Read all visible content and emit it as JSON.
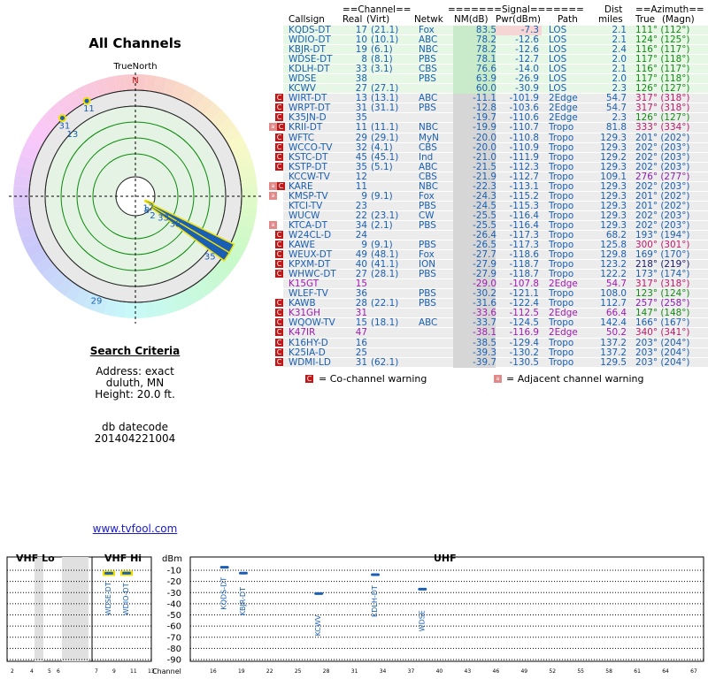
{
  "page": {
    "title": "All Channels",
    "north_label": "TrueNorth",
    "north_marker": "N",
    "search_criteria_heading": "Search Criteria",
    "address_line": "Address: exact",
    "city_line": "duluth, MN",
    "height_line": "Height: 20.0 ft.",
    "datecode_label": "db datecode",
    "datecode_value": "201404221004",
    "site_link": "www.tvfool.com"
  },
  "radar": {
    "markers": [
      {
        "ch": "11",
        "azimuth": 333,
        "ring": 5.5,
        "color": "#f0e000"
      },
      {
        "ch": "31",
        "azimuth": 317,
        "ring": 5.5,
        "color": "#f0e000"
      },
      {
        "ch": "13",
        "azimuth": 317,
        "ring": 4.9,
        "color": "#1a5fb4"
      },
      {
        "ch": "17",
        "azimuth": 111,
        "ring": 0.6,
        "color": "#1a5fb4"
      },
      {
        "ch": "8",
        "azimuth": 117,
        "ring": 0.7,
        "color": "#1a5fb4"
      },
      {
        "ch": "2",
        "azimuth": 123,
        "ring": 1.1,
        "color": "#1a5fb4"
      },
      {
        "ch": "33",
        "azimuth": 118,
        "ring": 1.5,
        "color": "#1a5fb4"
      },
      {
        "ch": "38",
        "azimuth": 118,
        "ring": 2.2,
        "color": "#1a5fb4"
      },
      {
        "ch": "35",
        "azimuth": 126,
        "ring": 4.6,
        "color": "#1a5fb4"
      },
      {
        "ch": "29",
        "azimuth": 203,
        "ring": 5.4,
        "color": "#1a5fb4"
      }
    ]
  },
  "table": {
    "header_group": {
      "channel": "==Channel==",
      "signal": "=======Signal=======",
      "dist": "Dist",
      "azimuth": "==Azimuth=="
    },
    "header": {
      "callsign": "Callsign",
      "real": "Real",
      "virt": "(Virt)",
      "netwk": "Netwk",
      "nm": "NM(dB)",
      "pwr": "Pwr(dBm)",
      "path": "Path",
      "miles": "miles",
      "true": "True",
      "magn": "(Magn)"
    },
    "rows": [
      {
        "call": "KQDS-DT",
        "real": "17",
        "virt": "(21.1)",
        "net": "Fox",
        "nm": "83.5",
        "pwr": "-7.3",
        "path": "LOS",
        "dist": "2.1",
        "az": "111° (112°)",
        "warn": "",
        "grp": "green",
        "col": "#1a5fb4",
        "azcol": "#138a13"
      },
      {
        "call": "WDIO-DT",
        "real": "10",
        "virt": "(10.1)",
        "net": "ABC",
        "nm": "78.2",
        "pwr": "-12.6",
        "path": "LOS",
        "dist": "2.1",
        "az": "124° (125°)",
        "warn": "",
        "grp": "green",
        "col": "#1a5fb4",
        "azcol": "#138a13"
      },
      {
        "call": "KBJR-DT",
        "real": "19",
        "virt": "(6.1)",
        "net": "NBC",
        "nm": "78.2",
        "pwr": "-12.6",
        "path": "LOS",
        "dist": "2.4",
        "az": "116° (117°)",
        "warn": "",
        "grp": "green",
        "col": "#1a5fb4",
        "azcol": "#138a13"
      },
      {
        "call": "WDSE-DT",
        "real": "8",
        "virt": "(8.1)",
        "net": "PBS",
        "nm": "78.1",
        "pwr": "-12.7",
        "path": "LOS",
        "dist": "2.0",
        "az": "117° (118°)",
        "warn": "",
        "grp": "green",
        "col": "#1a5fb4",
        "azcol": "#138a13"
      },
      {
        "call": "KDLH-DT",
        "real": "33",
        "virt": "(3.1)",
        "net": "CBS",
        "nm": "76.6",
        "pwr": "-14.0",
        "path": "LOS",
        "dist": "2.1",
        "az": "116° (117°)",
        "warn": "",
        "grp": "green",
        "col": "#1a5fb4",
        "azcol": "#138a13"
      },
      {
        "call": "WDSE",
        "real": "38",
        "virt": "",
        "net": "PBS",
        "nm": "63.9",
        "pwr": "-26.9",
        "path": "LOS",
        "dist": "2.0",
        "az": "117° (118°)",
        "warn": "",
        "grp": "green",
        "col": "#1a5fb4",
        "azcol": "#138a13"
      },
      {
        "call": "KCWV",
        "real": "27",
        "virt": "(27.1)",
        "net": "",
        "nm": "60.0",
        "pwr": "-30.9",
        "path": "LOS",
        "dist": "2.3",
        "az": "126° (127°)",
        "warn": "",
        "grp": "green",
        "col": "#1a5fb4",
        "azcol": "#138a13"
      },
      {
        "call": "WIRT-DT",
        "real": "13",
        "virt": "(13.1)",
        "net": "ABC",
        "nm": "-11.1",
        "pwr": "-101.9",
        "path": "2Edge",
        "dist": "54.7",
        "az": "317° (318°)",
        "warn": "co",
        "grp": "gray",
        "col": "#1a5fb4",
        "azcol": "#c0186a"
      },
      {
        "call": "WRPT-DT",
        "real": "31",
        "virt": "(31.1)",
        "net": "PBS",
        "nm": "-12.8",
        "pwr": "-103.6",
        "path": "2Edge",
        "dist": "54.7",
        "az": "317° (318°)",
        "warn": "co",
        "grp": "gray",
        "col": "#1a5fb4",
        "azcol": "#c0186a"
      },
      {
        "call": "K35JN-D",
        "real": "35",
        "virt": "",
        "net": "",
        "nm": "-19.7",
        "pwr": "-110.6",
        "path": "2Edge",
        "dist": "2.3",
        "az": "126° (127°)",
        "warn": "co",
        "grp": "gray",
        "col": "#1a5fb4",
        "azcol": "#138a13"
      },
      {
        "call": "KRII-DT",
        "real": "11",
        "virt": "(11.1)",
        "net": "NBC",
        "nm": "-19.9",
        "pwr": "-110.7",
        "path": "Tropo",
        "dist": "81.8",
        "az": "333° (334°)",
        "warn": "co adj",
        "grp": "gray",
        "col": "#1a5fb4",
        "azcol": "#c0186a"
      },
      {
        "call": "WFTC",
        "real": "29",
        "virt": "(29.1)",
        "net": "MyN",
        "nm": "-20.0",
        "pwr": "-110.8",
        "path": "Tropo",
        "dist": "129.3",
        "az": "201° (202°)",
        "warn": "co",
        "grp": "gray",
        "col": "#1a5fb4",
        "azcol": "#1a5fb4"
      },
      {
        "call": "WCCO-TV",
        "real": "32",
        "virt": "(4.1)",
        "net": "CBS",
        "nm": "-20.0",
        "pwr": "-110.9",
        "path": "Tropo",
        "dist": "129.3",
        "az": "202° (203°)",
        "warn": "co",
        "grp": "gray",
        "col": "#1a5fb4",
        "azcol": "#1a5fb4"
      },
      {
        "call": "KSTC-DT",
        "real": "45",
        "virt": "(45.1)",
        "net": "Ind",
        "nm": "-21.0",
        "pwr": "-111.9",
        "path": "Tropo",
        "dist": "129.2",
        "az": "202° (203°)",
        "warn": "co",
        "grp": "gray",
        "col": "#1a5fb4",
        "azcol": "#1a5fb4"
      },
      {
        "call": "KSTP-DT",
        "real": "35",
        "virt": "(5.1)",
        "net": "ABC",
        "nm": "-21.5",
        "pwr": "-112.3",
        "path": "Tropo",
        "dist": "129.3",
        "az": "202° (203°)",
        "warn": "co",
        "grp": "gray",
        "col": "#1a5fb4",
        "azcol": "#1a5fb4"
      },
      {
        "call": "KCCW-TV",
        "real": "12",
        "virt": "",
        "net": "CBS",
        "nm": "-21.9",
        "pwr": "-112.7",
        "path": "Tropo",
        "dist": "109.1",
        "az": "276° (277°)",
        "warn": "",
        "grp": "gray",
        "col": "#1a5fb4",
        "azcol": "#8a1ab4"
      },
      {
        "call": "KARE",
        "real": "11",
        "virt": "",
        "net": "NBC",
        "nm": "-22.3",
        "pwr": "-113.1",
        "path": "Tropo",
        "dist": "129.3",
        "az": "202° (203°)",
        "warn": "co adj",
        "grp": "gray",
        "col": "#1a5fb4",
        "azcol": "#1a5fb4"
      },
      {
        "call": "KMSP-TV",
        "real": "9",
        "virt": "(9.1)",
        "net": "Fox",
        "nm": "-24.3",
        "pwr": "-115.2",
        "path": "Tropo",
        "dist": "129.3",
        "az": "201° (202°)",
        "warn": "adj",
        "grp": "gray",
        "col": "#1a5fb4",
        "azcol": "#1a5fb4"
      },
      {
        "call": "KTCI-TV",
        "real": "23",
        "virt": "",
        "net": "PBS",
        "nm": "-24.5",
        "pwr": "-115.3",
        "path": "Tropo",
        "dist": "129.3",
        "az": "201° (202°)",
        "warn": "",
        "grp": "gray",
        "col": "#1a5fb4",
        "azcol": "#1a5fb4"
      },
      {
        "call": "WUCW",
        "real": "22",
        "virt": "(23.1)",
        "net": "CW",
        "nm": "-25.5",
        "pwr": "-116.4",
        "path": "Tropo",
        "dist": "129.3",
        "az": "202° (203°)",
        "warn": "",
        "grp": "gray",
        "col": "#1a5fb4",
        "azcol": "#1a5fb4"
      },
      {
        "call": "KTCA-DT",
        "real": "34",
        "virt": "(2.1)",
        "net": "PBS",
        "nm": "-25.5",
        "pwr": "-116.4",
        "path": "Tropo",
        "dist": "129.3",
        "az": "202° (203°)",
        "warn": "adj",
        "grp": "gray",
        "col": "#1a5fb4",
        "azcol": "#1a5fb4"
      },
      {
        "call": "W24CL-D",
        "real": "24",
        "virt": "",
        "net": "",
        "nm": "-26.4",
        "pwr": "-117.3",
        "path": "Tropo",
        "dist": "68.2",
        "az": "193° (194°)",
        "warn": "co",
        "grp": "gray",
        "col": "#1a5fb4",
        "azcol": "#1a5fb4"
      },
      {
        "call": "KAWE",
        "real": "9",
        "virt": "(9.1)",
        "net": "PBS",
        "nm": "-26.5",
        "pwr": "-117.3",
        "path": "Tropo",
        "dist": "125.8",
        "az": "300° (301°)",
        "warn": "co",
        "grp": "gray",
        "col": "#1a5fb4",
        "azcol": "#c0186a"
      },
      {
        "call": "WEUX-DT",
        "real": "49",
        "virt": "(48.1)",
        "net": "Fox",
        "nm": "-27.7",
        "pwr": "-118.6",
        "path": "Tropo",
        "dist": "129.8",
        "az": "169° (170°)",
        "warn": "co",
        "grp": "gray",
        "col": "#1a5fb4",
        "azcol": "#1a5fb4"
      },
      {
        "call": "KPXM-DT",
        "real": "40",
        "virt": "(41.1)",
        "net": "ION",
        "nm": "-27.9",
        "pwr": "-118.7",
        "path": "Tropo",
        "dist": "123.2",
        "az": "218° (219°)",
        "warn": "co",
        "grp": "gray",
        "col": "#1a5fb4",
        "azcol": "#1a1a6a"
      },
      {
        "call": "WHWC-DT",
        "real": "27",
        "virt": "(28.1)",
        "net": "PBS",
        "nm": "-27.9",
        "pwr": "-118.7",
        "path": "Tropo",
        "dist": "122.2",
        "az": "173° (174°)",
        "warn": "co",
        "grp": "gray",
        "col": "#1a5fb4",
        "azcol": "#1a5fb4"
      },
      {
        "call": "K15GT",
        "real": "15",
        "virt": "",
        "net": "",
        "nm": "-29.0",
        "pwr": "-107.8",
        "path": "2Edge",
        "dist": "54.7",
        "az": "317° (318°)",
        "warn": "",
        "grp": "gray",
        "col": "#a01ab4",
        "azcol": "#c0186a"
      },
      {
        "call": "WLEF-TV",
        "real": "36",
        "virt": "",
        "net": "PBS",
        "nm": "-30.2",
        "pwr": "-121.1",
        "path": "Tropo",
        "dist": "108.0",
        "az": "123° (124°)",
        "warn": "",
        "grp": "gray",
        "col": "#1a5fb4",
        "azcol": "#138a13"
      },
      {
        "call": "KAWB",
        "real": "28",
        "virt": "(22.1)",
        "net": "PBS",
        "nm": "-31.6",
        "pwr": "-122.4",
        "path": "Tropo",
        "dist": "112.7",
        "az": "257° (258°)",
        "warn": "co",
        "grp": "gray",
        "col": "#1a5fb4",
        "azcol": "#8a1ab4"
      },
      {
        "call": "K31GH",
        "real": "31",
        "virt": "",
        "net": "",
        "nm": "-33.6",
        "pwr": "-112.5",
        "path": "2Edge",
        "dist": "66.4",
        "az": "147° (148°)",
        "warn": "co",
        "grp": "gray",
        "col": "#a01ab4",
        "azcol": "#138a13"
      },
      {
        "call": "WQOW-TV",
        "real": "15",
        "virt": "(18.1)",
        "net": "ABC",
        "nm": "-33.7",
        "pwr": "-124.5",
        "path": "Tropo",
        "dist": "142.4",
        "az": "166° (167°)",
        "warn": "co",
        "grp": "gray",
        "col": "#1a5fb4",
        "azcol": "#1a5fb4"
      },
      {
        "call": "K47IR",
        "real": "47",
        "virt": "",
        "net": "",
        "nm": "-38.1",
        "pwr": "-116.9",
        "path": "2Edge",
        "dist": "50.2",
        "az": "340° (341°)",
        "warn": "co",
        "grp": "gray",
        "col": "#a01ab4",
        "azcol": "#c0186a"
      },
      {
        "call": "K16HY-D",
        "real": "16",
        "virt": "",
        "net": "",
        "nm": "-38.5",
        "pwr": "-129.4",
        "path": "Tropo",
        "dist": "137.2",
        "az": "203° (204°)",
        "warn": "co",
        "grp": "gray",
        "col": "#1a5fb4",
        "azcol": "#1a5fb4"
      },
      {
        "call": "K25IA-D",
        "real": "25",
        "virt": "",
        "net": "",
        "nm": "-39.3",
        "pwr": "-130.2",
        "path": "Tropo",
        "dist": "137.2",
        "az": "203° (204°)",
        "warn": "co",
        "grp": "gray",
        "col": "#1a5fb4",
        "azcol": "#1a5fb4"
      },
      {
        "call": "WDMI-LD",
        "real": "31",
        "virt": "(62.1)",
        "net": "",
        "nm": "-39.7",
        "pwr": "-130.5",
        "path": "Tropo",
        "dist": "129.5",
        "az": "203° (204°)",
        "warn": "co",
        "grp": "gray",
        "col": "#1a5fb4",
        "azcol": "#1a5fb4"
      }
    ],
    "legend_co": "= Co-channel warning",
    "legend_adj": "= Adjacent channel warning",
    "warn_glyph": "C",
    "adj_glyph": "a"
  },
  "spectrum": {
    "vhf_lo_title": "VHF Lo",
    "vhf_hi_title": "VHF Hi",
    "uhf_title": "UHF",
    "dbm_label": "dBm",
    "channel_label": "Channel",
    "dbm_ticks": [
      "-10",
      "-20",
      "-30",
      "-40",
      "-50",
      "-60",
      "-70",
      "-80",
      "-90"
    ],
    "vhf_lo_channels": [
      "2",
      "4",
      "5",
      "6"
    ],
    "vhf_hi_channels": [
      "7",
      "9",
      "11",
      "13"
    ],
    "uhf_channels": [
      "16",
      "19",
      "22",
      "25",
      "28",
      "31",
      "34",
      "37",
      "40",
      "43",
      "46",
      "49",
      "52",
      "55",
      "58",
      "61",
      "64",
      "67",
      "69"
    ],
    "stations": [
      {
        "label": "WDSE-DT",
        "channel": 8,
        "dbm": -12.7,
        "highlight": true
      },
      {
        "label": "WDIO-DT",
        "channel": 10,
        "dbm": -12.6,
        "highlight": true
      },
      {
        "label": "KQDS-DT",
        "channel": 17,
        "dbm": -7.3,
        "highlight": false
      },
      {
        "label": "KBJR-DT",
        "channel": 19,
        "dbm": -12.6,
        "highlight": false
      },
      {
        "label": "KCWV",
        "channel": 27,
        "dbm": -30.9,
        "highlight": false
      },
      {
        "label": "KDLH-DT",
        "channel": 33,
        "dbm": -14.0,
        "highlight": false
      },
      {
        "label": "WDSE",
        "channel": 38,
        "dbm": -26.9,
        "highlight": false
      }
    ]
  },
  "colors": {
    "link": "#1a1acc",
    "station_blue": "#1a5fb4",
    "co_warning": "#c01818",
    "adj_warning": "#e28a8a",
    "highlight": "#f0e000"
  }
}
